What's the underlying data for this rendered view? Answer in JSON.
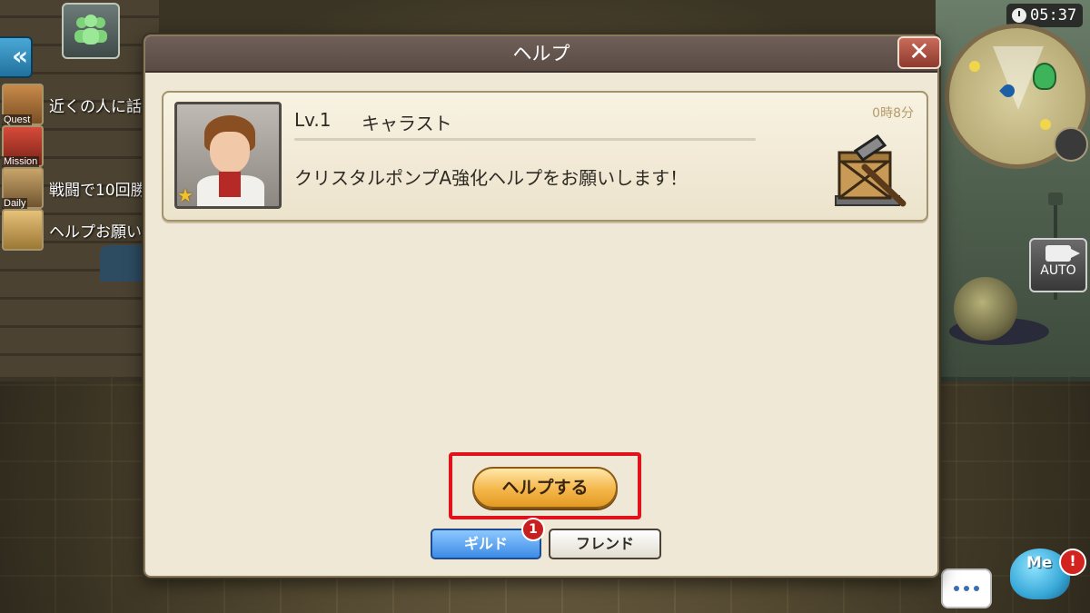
{
  "hud": {
    "clock": "05:37",
    "auto_label": "AUTO",
    "quest_items": [
      {
        "tag": "Quest",
        "text": "近くの人に話"
      },
      {
        "tag": "Mission",
        "text": ""
      },
      {
        "tag": "Daily",
        "text": "戦闘で10回勝"
      },
      {
        "tag": "",
        "text": "ヘルプお願い"
      }
    ],
    "mascot_label": "Me",
    "mascot_alert": "!"
  },
  "dialog": {
    "title": "ヘルプ",
    "close_symbol": "✕",
    "request": {
      "level": "Lv.1",
      "name": "キャラスト",
      "elapsed": "0時8分",
      "message": "クリスタルポンプA強化ヘルプをお願いします！"
    },
    "help_button": "ヘルプする",
    "tabs": {
      "guild": "ギルド",
      "guild_badge": "1",
      "friend": "フレンド"
    }
  },
  "colors": {
    "highlight": "#e1121b",
    "accent_orange": "#f4b64a",
    "guild_blue": "#3d8be6"
  },
  "icons": [
    "back-arrows-icon",
    "party-icon",
    "clock-icon",
    "minimap",
    "camera-icon",
    "close-icon",
    "hammer-crate-icon",
    "chat-icon",
    "star-icon"
  ]
}
